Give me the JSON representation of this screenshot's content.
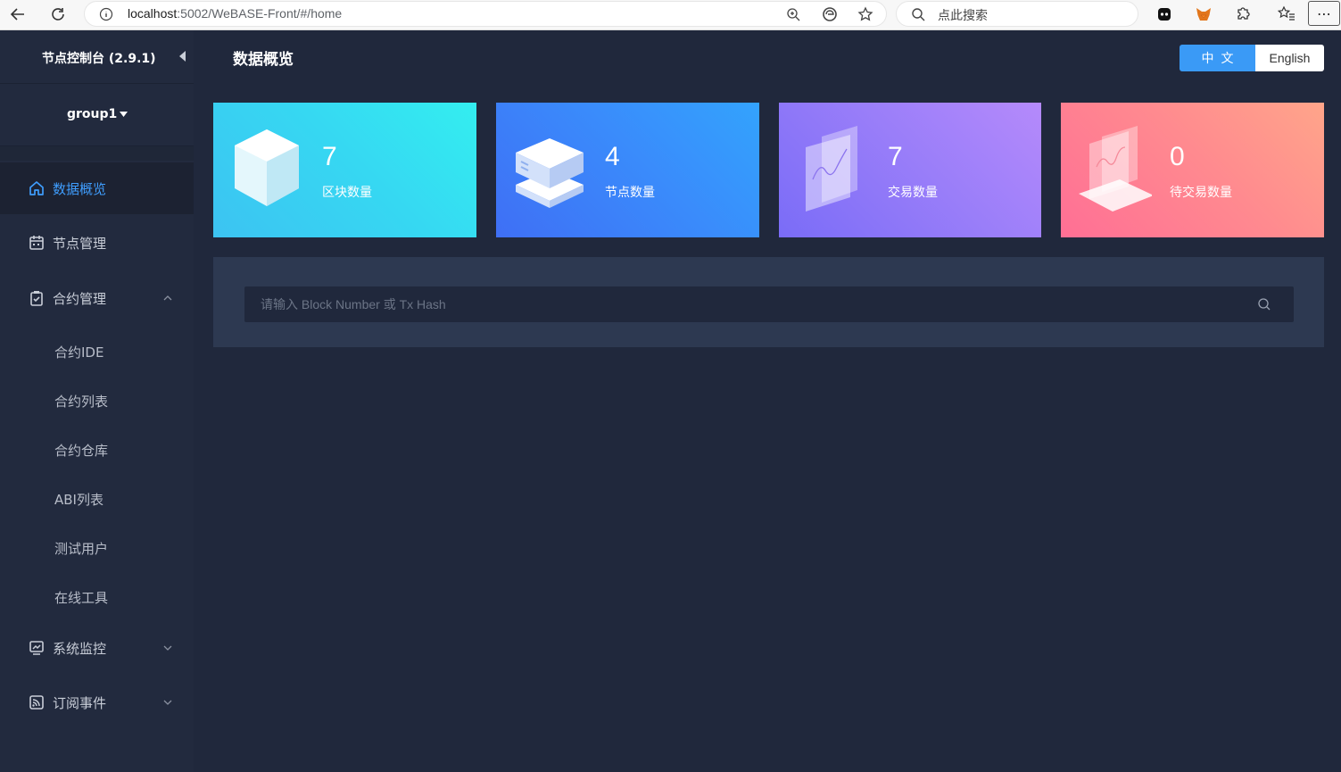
{
  "browser": {
    "url_host": "localhost",
    "url_path": ":5002/WeBASE-Front/#/home",
    "search_placeholder": "点此搜索"
  },
  "sidebar": {
    "title": "节点控制台 (2.9.1)",
    "group": "group1",
    "items": [
      {
        "label": "数据概览",
        "icon": "home-icon",
        "active": true
      },
      {
        "label": "节点管理",
        "icon": "calendar-icon"
      },
      {
        "label": "合约管理",
        "icon": "clipboard-check-icon",
        "expanded": true
      },
      {
        "label": "系统监控",
        "icon": "monitor-chart-icon"
      },
      {
        "label": "订阅事件",
        "icon": "rss-icon"
      }
    ],
    "contract_sub": [
      "合约IDE",
      "合约列表",
      "合约仓库",
      "ABI列表",
      "测试用户",
      "在线工具"
    ]
  },
  "header": {
    "title": "数据概览",
    "lang_zh": "中文",
    "lang_en": "English"
  },
  "stats": [
    {
      "value": "7",
      "label": "区块数量",
      "icon": "cube-icon"
    },
    {
      "value": "4",
      "label": "节点数量",
      "icon": "server-stack-icon"
    },
    {
      "value": "7",
      "label": "交易数量",
      "icon": "chart-panel-icon"
    },
    {
      "value": "0",
      "label": "待交易数量",
      "icon": "pending-panel-icon"
    }
  ],
  "search": {
    "placeholder": "请输入 Block Number 或 Tx Hash"
  },
  "colors": {
    "accent": "#3a9af6",
    "active_nav": "#3f9dfd",
    "sidebar_bg": "#222a3e",
    "main_bg": "#20283c"
  }
}
